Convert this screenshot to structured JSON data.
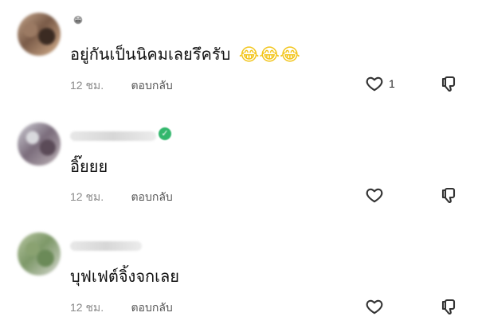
{
  "comments": [
    {
      "badge": "😁",
      "text": "อยู่กันเป็นนิคมเลยรึครับ",
      "emojis": "😂😂😂",
      "time": "12 ชม.",
      "reply": "ตอบกลับ",
      "likes": "1"
    },
    {
      "text": "อิ๊ยยย",
      "time": "12 ชม.",
      "reply": "ตอบกลับ"
    },
    {
      "text": "บุฟเฟต์จิ้งจกเลย",
      "time": "12 ชม.",
      "reply": "ตอบกลับ"
    }
  ],
  "colors": {
    "text": "#111111",
    "meta": "#8a8a8a",
    "icon": "#333333",
    "badge_green": "#32b76c"
  },
  "icons": {
    "like": "heart-icon",
    "dislike": "thumbs-down-icon"
  }
}
